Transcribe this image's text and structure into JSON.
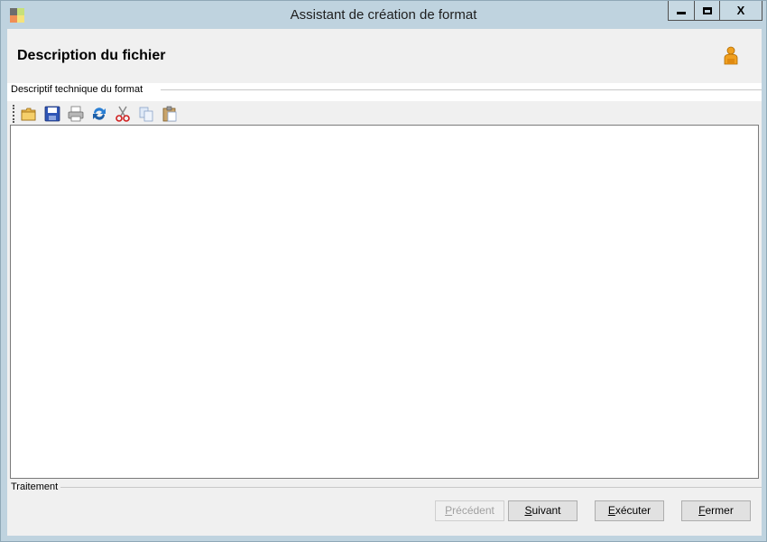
{
  "window": {
    "title": "Assistant de création de format",
    "controls": {
      "minimize_icon": "minimize-icon",
      "maximize_icon": "maximize-icon",
      "close_label": "X"
    }
  },
  "header": {
    "title": "Description du fichier",
    "icon": "user-icon"
  },
  "groups": {
    "format_label": "Descriptif technique du format",
    "processing_label": "Traitement"
  },
  "toolbar": {
    "items": [
      {
        "name": "open-icon"
      },
      {
        "name": "save-icon"
      },
      {
        "name": "print-icon"
      },
      {
        "name": "refresh-icon"
      },
      {
        "name": "cut-icon"
      },
      {
        "name": "copy-icon"
      },
      {
        "name": "paste-icon"
      }
    ]
  },
  "editor": {
    "content": ""
  },
  "buttons": {
    "previous": {
      "first": "P",
      "rest": "récédent",
      "enabled": false
    },
    "next": {
      "first": "S",
      "rest": "uivant",
      "enabled": true
    },
    "execute": {
      "first": "E",
      "rest": "xécuter",
      "enabled": true
    },
    "close": {
      "first": "F",
      "rest": "ermer",
      "enabled": true
    }
  },
  "colors": {
    "titlebar": "#bfd3df",
    "client": "#f0f0f0",
    "accent_user": "#f0a020"
  }
}
